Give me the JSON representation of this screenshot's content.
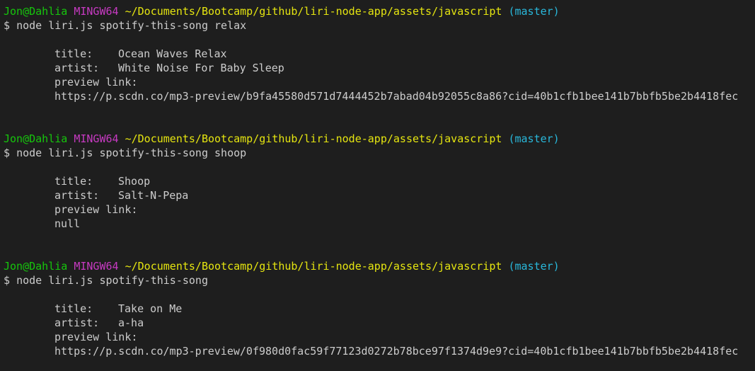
{
  "terminal": {
    "prompt_user": "Jon",
    "prompt_at": "@",
    "prompt_host": "Dahlia",
    "prompt_system": "MINGW64",
    "prompt_path": "~/Documents/Bootcamp/github/liri-node-app/assets/javascript",
    "prompt_branch": "(master)",
    "prompt_symbol": "$",
    "labels": {
      "title": "title:",
      "artist": "artist:",
      "preview": "preview link:"
    },
    "sessions": [
      {
        "command": "node liri.js spotify-this-song relax",
        "title": "Ocean Waves Relax",
        "artist": "White Noise For Baby Sleep",
        "preview": "https://p.scdn.co/mp3-preview/b9fa45580d571d7444452b7abad04b92055c8a86?cid=40b1cfb1bee141b7bbfb5be2b4418fec"
      },
      {
        "command": "node liri.js spotify-this-song shoop",
        "title": "Shoop",
        "artist": "Salt-N-Pepa",
        "preview": "null"
      },
      {
        "command": "node liri.js spotify-this-song",
        "title": "Take on Me",
        "artist": "a-ha",
        "preview": "https://p.scdn.co/mp3-preview/0f980d0fac59f77123d0272b78bce97f1374d9e9?cid=40b1cfb1bee141b7bbfb5be2b4418fec"
      }
    ]
  },
  "colors": {
    "background": "#1e1e1e",
    "text": "#cccccc",
    "user_host": "#16c60c",
    "system": "#c73ac2",
    "path": "#e5e510",
    "branch": "#29b8db"
  }
}
